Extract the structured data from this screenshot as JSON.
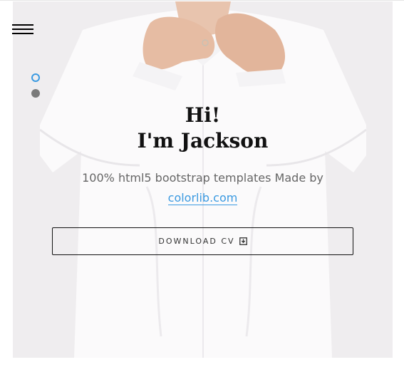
{
  "hero": {
    "heading_line1": "Hi!",
    "heading_line2": "I'm Jackson",
    "subtitle_text": "100% html5 bootstrap templates Made by",
    "subtitle_link": "colorlib.com",
    "download_label": "DOWNLOAD CV",
    "download_icon": "download-icon"
  },
  "nav": {
    "menu_icon": "hamburger-menu-icon"
  },
  "slider": {
    "active_index": 0,
    "count": 2
  },
  "colors": {
    "accent": "#3b9ae1",
    "background": "#efedef",
    "text": "#111111"
  }
}
